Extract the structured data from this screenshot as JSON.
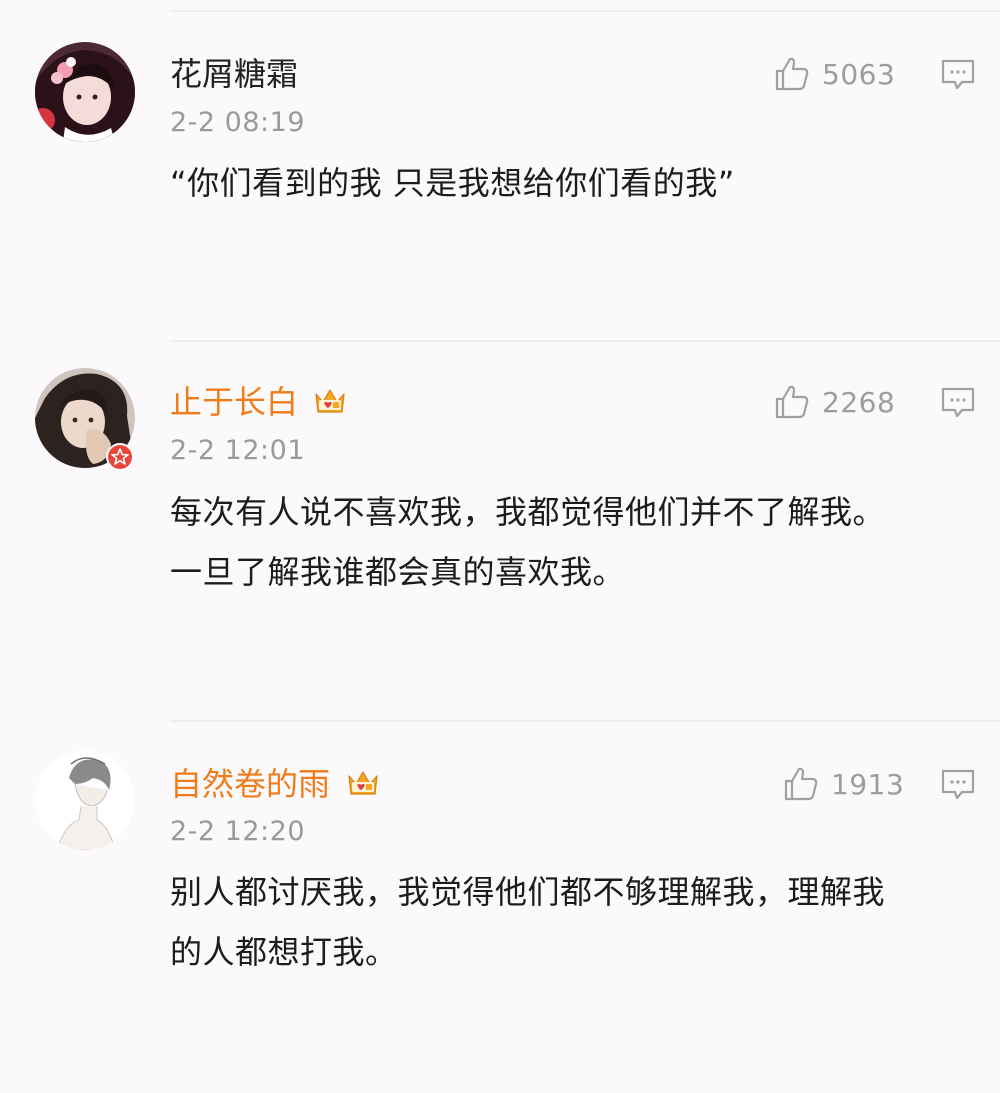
{
  "comments": [
    {
      "username": "花屑糖霜",
      "time": "2-2 08:19",
      "likes": "5063",
      "lines": [
        "“你们看到的我  只是我想给你们看的我”"
      ],
      "vip": false,
      "avatar_icon": "girl-avatar"
    },
    {
      "username": "止于长白",
      "time": "2-2 12:01",
      "likes": "2268",
      "lines": [
        "每次有人说不喜欢我，我都觉得他们并不了解我。",
        "一旦了解我谁都会真的喜欢我。"
      ],
      "vip": true,
      "avatar_icon": "person-avatar"
    },
    {
      "username": "自然卷的雨",
      "time": "2-2 12:20",
      "likes": "1913",
      "lines": [
        "别人都讨厌我，我觉得他们都不够理解我，理解我",
        "的人都想打我。"
      ],
      "vip": true,
      "avatar_icon": "sketch-avatar"
    }
  ],
  "colors": {
    "vip_name": "#f07c19",
    "normal_name": "#222222",
    "meta_gray": "#9a9a9a",
    "badge_red": "#e8463a",
    "crown_gold": "#f5a623"
  },
  "icons": {
    "like": "thumbs-up-icon",
    "reply": "comment-bubble-icon",
    "crown": "crown-icon",
    "badge": "verified-star-icon"
  }
}
